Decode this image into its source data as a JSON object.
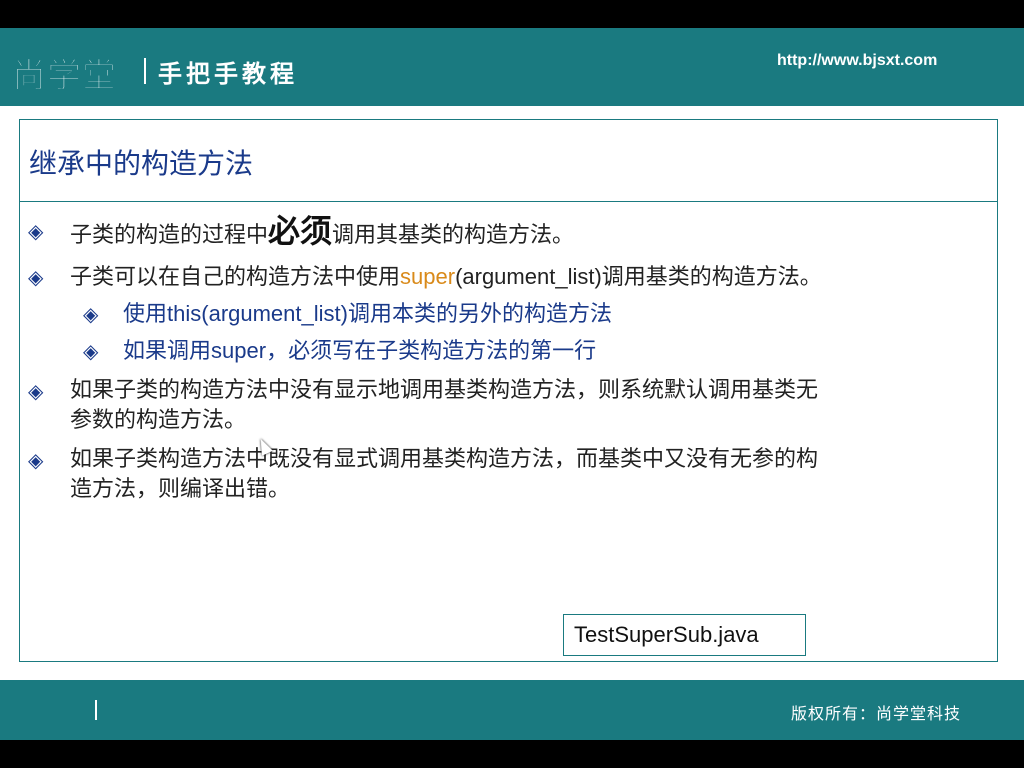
{
  "header": {
    "logo_text": "尚学堂",
    "subtitle": "手把手教程",
    "url": "http://www.bjsxt.com"
  },
  "slide": {
    "title": "继承中的构造方法",
    "bullets": [
      {
        "pre": "子类的构造的过程中",
        "emph": "必须",
        "post": "调用其基类的构造方法。"
      },
      {
        "pre": "子类可以在自己的构造方法中使用",
        "kw": "super",
        "post": "(argument_list)调用基类的构造方法。"
      },
      {
        "sub": true,
        "pre": "使用",
        "kw": "this(argument_list)",
        "post": "调用本类的另外的构造方法"
      },
      {
        "sub": true,
        "pre": "如果调用",
        "kw": "super",
        "post": "，必须写在子类构造方法的第一行"
      },
      {
        "line1": "如果子类的构造方法中没有显示地调用基类构造方法，则系统默认调用基类无",
        "line2": "参数的构造方法。"
      },
      {
        "line1": "如果子类构造方法中既没有显式调用基类构造方法，而基类中又没有无参的构",
        "line2": "造方法，则编译出错。"
      }
    ],
    "file_label": "TestSuperSub.java"
  },
  "footer": {
    "copyright": "版权所有：尚学堂科技"
  },
  "bullet_icon": "diamond-bullet-icon",
  "colors": {
    "teal": "#1a7a80",
    "title_blue": "#1a3a8a",
    "keyword_orange": "#d98a1a"
  }
}
